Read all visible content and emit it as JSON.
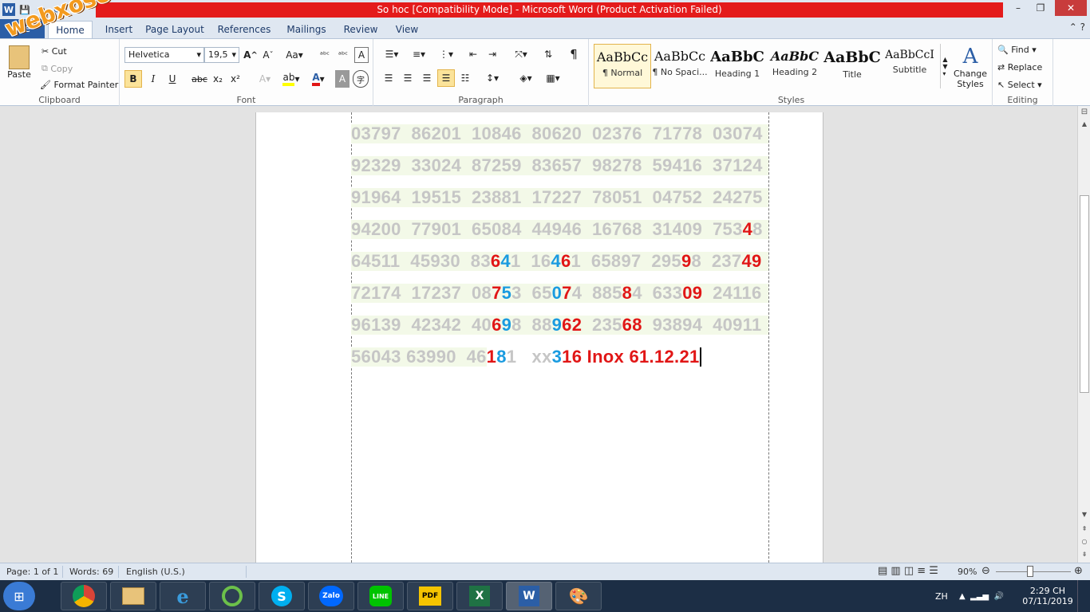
{
  "title_bar": {
    "title": "So hoc [Compatibility Mode]  -  Microsoft Word (Product Activation Failed)",
    "minimize": "–",
    "restore": "❐",
    "close": "✕"
  },
  "tabs": [
    "File",
    "Home",
    "Insert",
    "Page Layout",
    "References",
    "Mailings",
    "Review",
    "View"
  ],
  "clipboard": {
    "paste": "Paste",
    "cut": "Cut",
    "copy": "Copy",
    "format_painter": "Format Painter",
    "label": "Clipboard"
  },
  "font": {
    "name": "Helvetica",
    "size": "19,5",
    "label": "Font",
    "bold": "B",
    "italic": "I",
    "underline": "U",
    "strike": "abc",
    "sub": "x₂",
    "sup": "x²"
  },
  "paragraph": {
    "label": "Paragraph",
    "pilcrow": "¶"
  },
  "styles": {
    "label": "Styles",
    "items": [
      {
        "sample": "AaBbCc",
        "name": "¶ Normal"
      },
      {
        "sample": "AaBbCc",
        "name": "¶ No Spaci..."
      },
      {
        "sample": "AaBbC",
        "name": "Heading 1"
      },
      {
        "sample": "AaBbC",
        "name": "Heading 2"
      },
      {
        "sample": "AaBbC",
        "name": "Title"
      },
      {
        "sample": "AaBbCcI",
        "name": "Subtitle"
      }
    ],
    "change_styles": "Change Styles"
  },
  "editing": {
    "label": "Editing",
    "find": "Find",
    "replace": "Replace",
    "select": "Select"
  },
  "watermark": "webxoso.net",
  "document": {
    "rows": [
      "03797  86201  10846  80620  02376  71778  03074",
      "92329  33024  87259  83657  98278  59416  37124",
      "91964  19515  23881  17227  78051  04752  24275",
      "94200  77901  65084  44946  16768  31409  75348",
      "64511  45930  83641  16461  65897  29598  23749",
      "72174  17237  08753  65074  88584  63309  24116",
      "96139  42342  40698  88962  23568  93894  40911"
    ],
    "last_row_plain": "56043 63990  46",
    "last_row_mid": "xx",
    "last_row_tail": "16 Inox 61.12.21"
  },
  "status_bar": {
    "page": "Page: 1 of 1",
    "words": "Words: 69",
    "language": "English (U.S.)",
    "zoom": "90%"
  },
  "taskbar": {
    "apps": [
      "Chrome",
      "Explorer",
      "IE",
      "360",
      "Skype",
      "Zalo",
      "LINE",
      "PDF",
      "Excel",
      "Word",
      "Paint"
    ],
    "lang": "ZH",
    "time": "2:29 CH",
    "date": "07/11/2019"
  }
}
